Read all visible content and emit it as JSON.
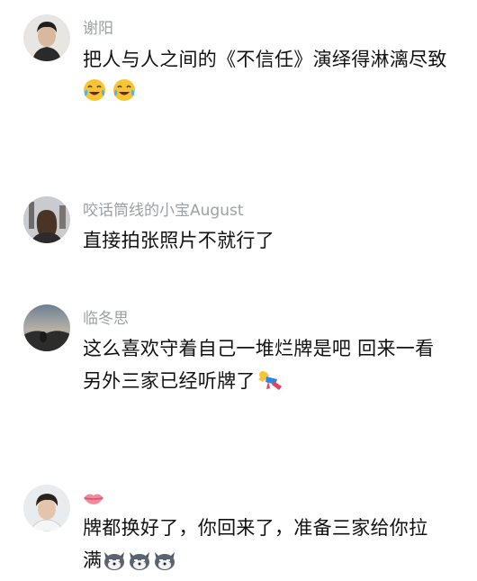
{
  "comments": [
    {
      "username": "谢阳",
      "text": "把人与人之间的《不信任》演绎得淋漓尽致",
      "emojis": [
        "crying-laughing-emoji",
        "crying-laughing-emoji"
      ]
    },
    {
      "username": "咬话筒线的小宝August",
      "text": "直接拍张照片不就行了",
      "emojis": []
    },
    {
      "username": "临冬思",
      "text_line1": "这么喜欢守着自己一堆烂牌是吧 回来一看",
      "text_line2": "另外三家已经听牌了",
      "emojis": [
        "falling-person-emoji"
      ]
    },
    {
      "username_icon": "lips-icon",
      "text_line1": "牌都换好了，你回来了，准备三家给你拉",
      "text_line2": "满",
      "emojis": [
        "husky-dog-emoji",
        "husky-dog-emoji",
        "husky-dog-emoji"
      ]
    }
  ]
}
